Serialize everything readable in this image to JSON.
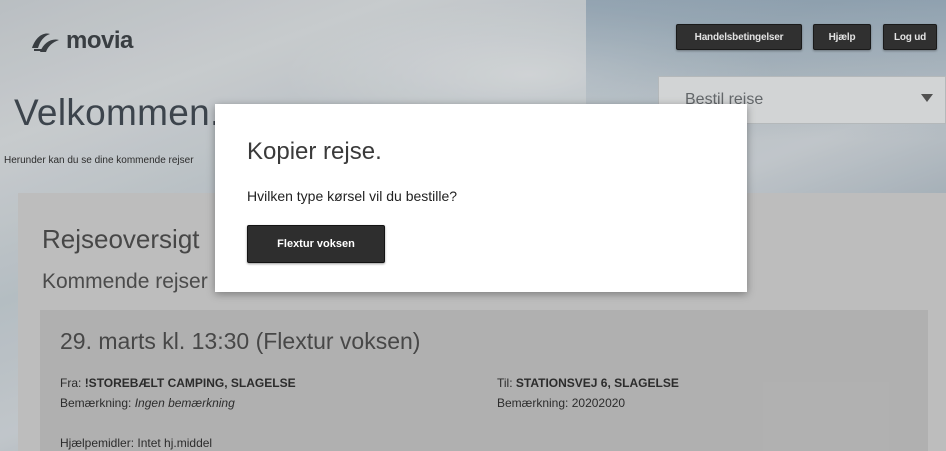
{
  "header": {
    "logo_text": "movia",
    "buttons": {
      "terms": "Handelsbetingelser",
      "help": "Hjælp",
      "logout": "Log ud"
    }
  },
  "welcome": {
    "title": "Velkommen.",
    "intro": "Herunder kan du se dine kommende rejser"
  },
  "order_select": {
    "selected": "Bestil rejse"
  },
  "overview": {
    "title": "Rejseoversigt",
    "subtitle": "Kommende rejser"
  },
  "trip": {
    "heading": "29. marts kl. 13:30 (Flextur voksen)",
    "from_label": "Fra:",
    "from_value": "!STOREBÆLT CAMPING, SLAGELSE",
    "to_label": "Til:",
    "to_value": "STATIONSVEJ 6, SLAGELSE",
    "remark_label_from": "Bemærkning:",
    "remark_value_from": "Ingen bemærkning",
    "remark_label_to": "Bemærkning:",
    "remark_value_to": "20202020",
    "aids_label": "Hjælpemidler:",
    "aids_value": "Intet hj.middel"
  },
  "modal": {
    "title": "Kopier rejse.",
    "question": "Hvilken type kørsel vil du bestille?",
    "option_button": "Flextur voksen"
  },
  "colors": {
    "button_dark": "#2e2e2e",
    "panel_bg": "#d3d3d3",
    "card_bg": "#c4c4c4",
    "text_dark": "#3a3a3a"
  }
}
